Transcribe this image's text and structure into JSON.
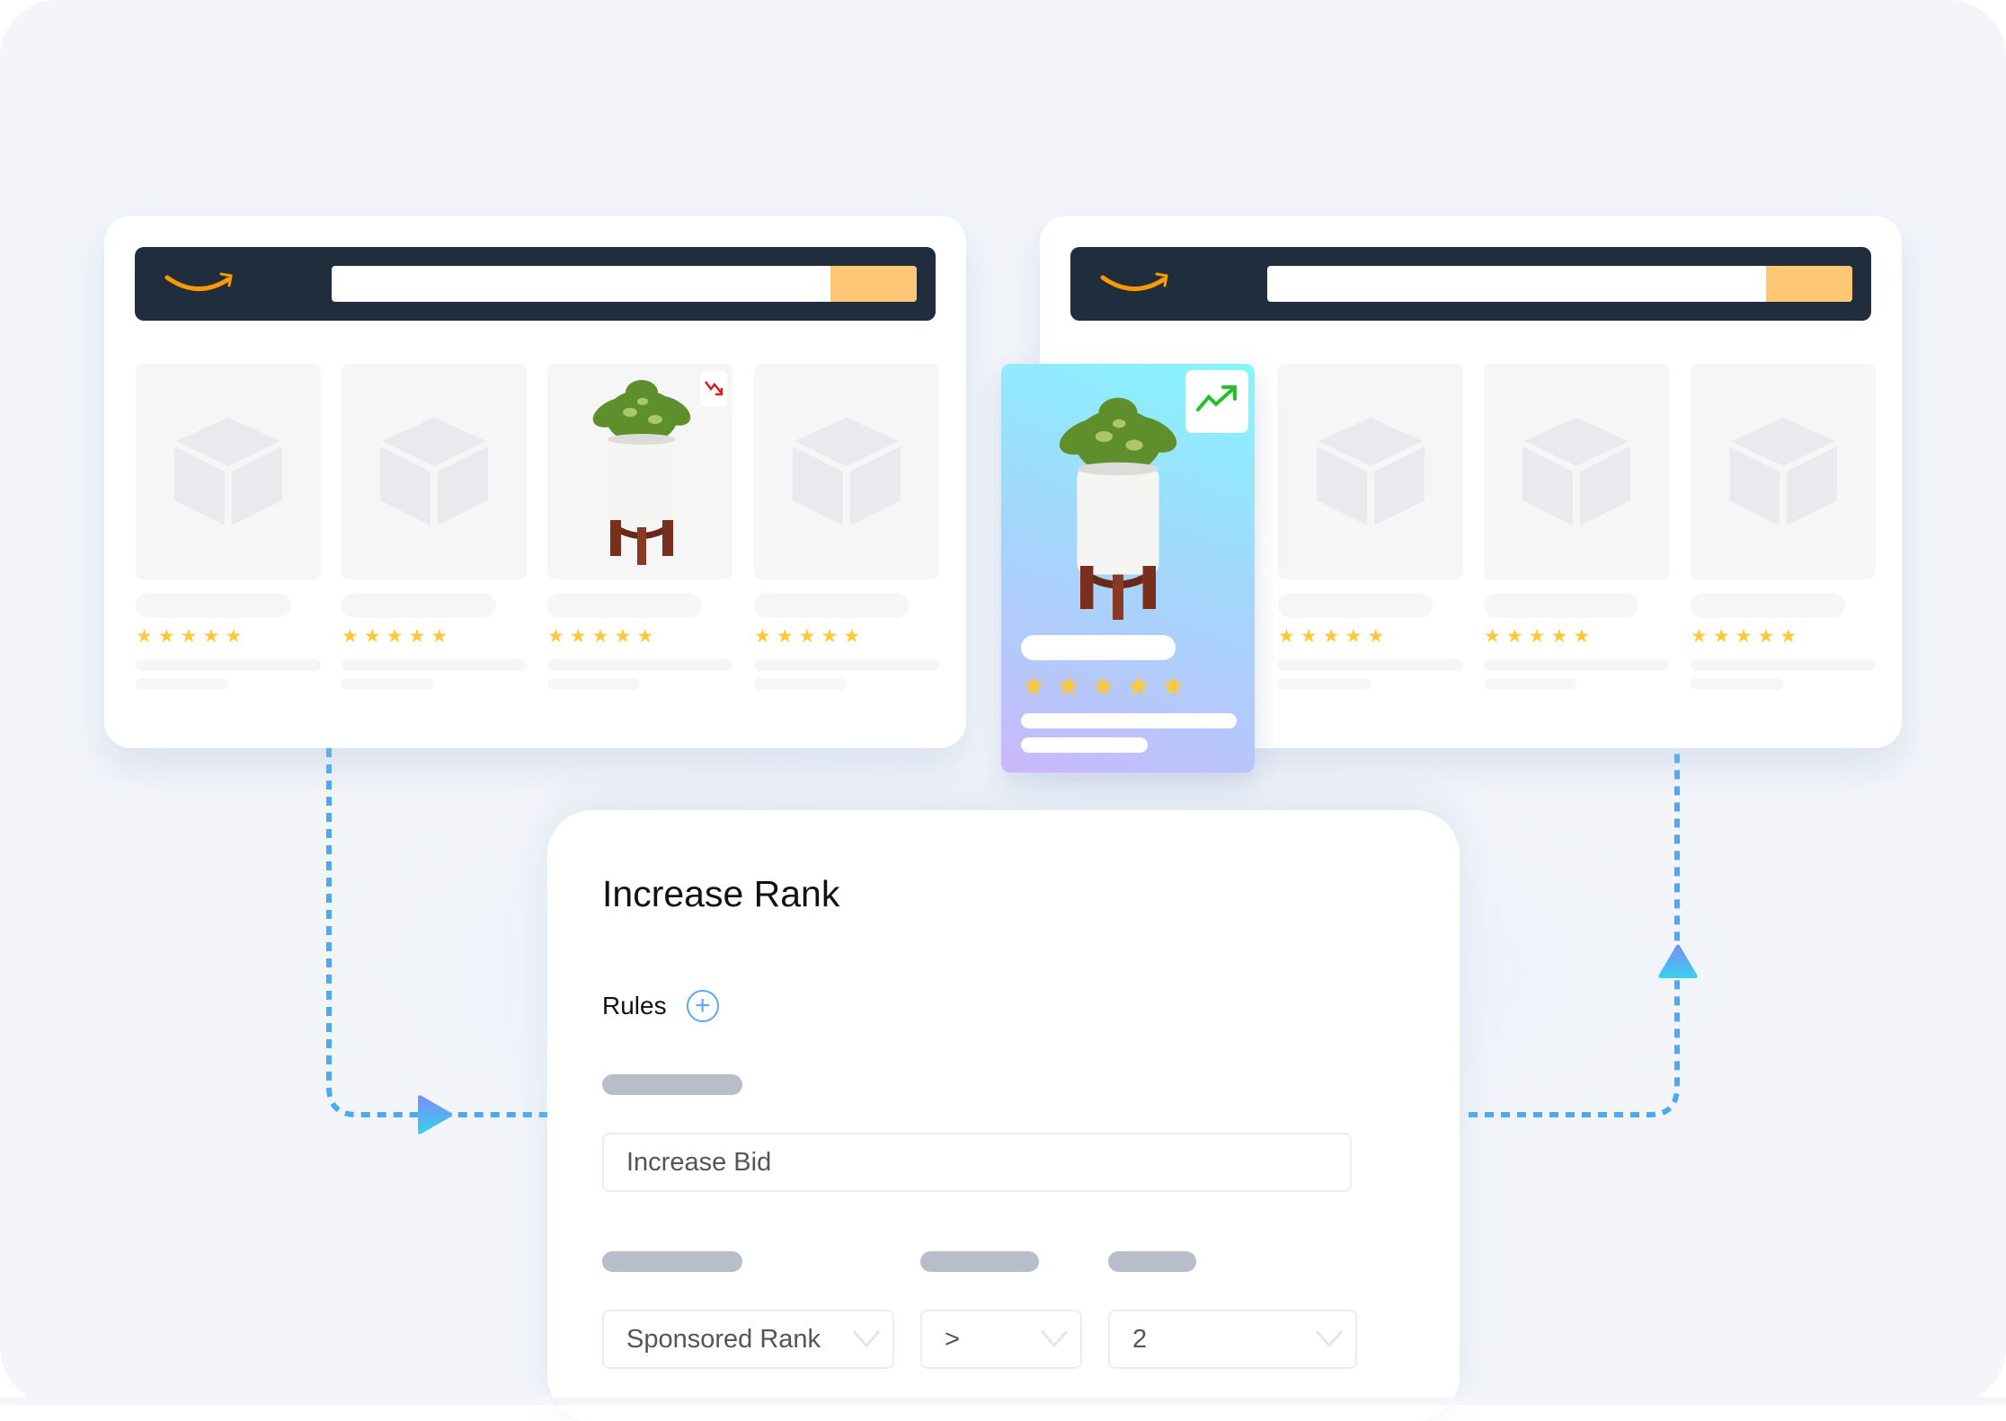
{
  "brand": {
    "logo_icon": "amazon-smile-icon",
    "logo_color": "#ff9900",
    "header_color": "#1f2d3d",
    "search_button_color": "#fec677"
  },
  "before_window": {
    "search_value": "",
    "products": [
      {
        "type": "placeholder",
        "image_icon": "box-icon",
        "rating": 5
      },
      {
        "type": "placeholder",
        "image_icon": "box-icon",
        "rating": 5
      },
      {
        "type": "plant",
        "image_icon": "potted-plant-image",
        "rating": 5,
        "trend_icon": "trend-down-icon",
        "trend_color": "#d42020"
      },
      {
        "type": "placeholder",
        "image_icon": "box-icon",
        "rating": 5
      }
    ]
  },
  "after_window": {
    "search_value": "",
    "highlighted_product": {
      "image_icon": "potted-plant-image",
      "rating": 5,
      "trend_icon": "trend-up-icon",
      "trend_color": "#22c02a"
    },
    "products": [
      {
        "type": "placeholder",
        "image_icon": "box-icon",
        "rating": 5
      },
      {
        "type": "placeholder",
        "image_icon": "box-icon",
        "rating": 5
      },
      {
        "type": "placeholder",
        "image_icon": "box-icon",
        "rating": 5
      }
    ]
  },
  "stars": "★",
  "panel": {
    "title": "Increase Rank",
    "rules_label": "Rules",
    "add_rule_symbol": "+",
    "action_value": "Increase Bid",
    "condition": {
      "metric": "Sponsored Rank",
      "operator": ">",
      "value": "2"
    }
  },
  "colors": {
    "connector": "#4ea9ef",
    "accent_blue": "#5aa8f5",
    "star": "#ffc83a"
  }
}
